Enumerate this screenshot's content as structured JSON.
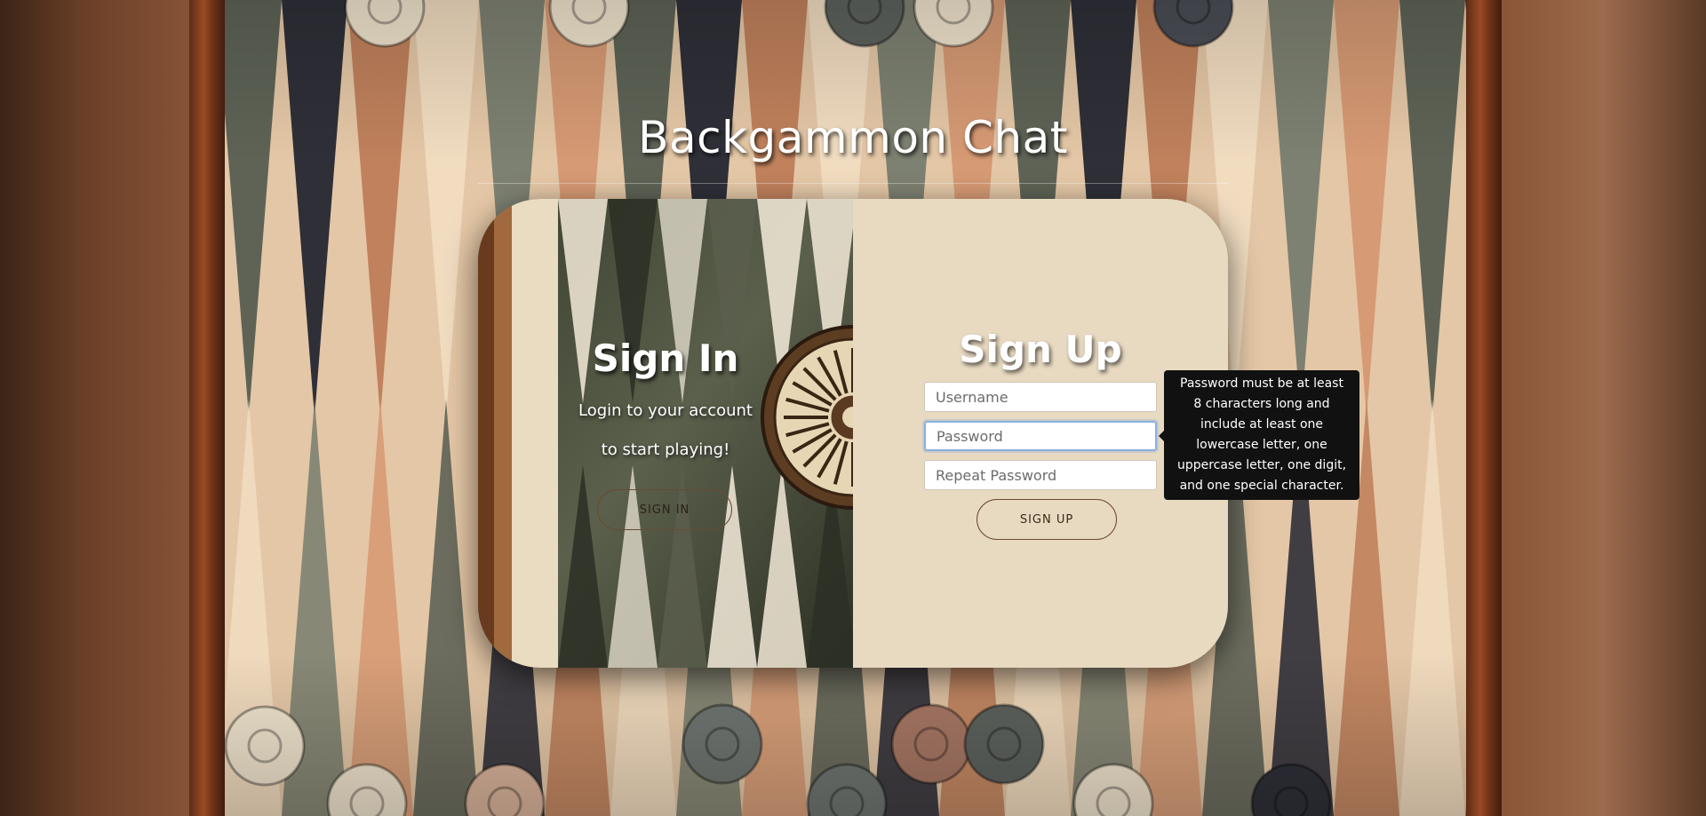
{
  "app": {
    "title": "Backgammon Chat"
  },
  "sign_in": {
    "heading": "Sign In",
    "line1": "Login to your account",
    "line2": "to start playing!",
    "button_label": "SIGN IN"
  },
  "sign_up": {
    "heading": "Sign Up",
    "username_placeholder": "Username",
    "password_placeholder": "Password",
    "repeat_password_placeholder": "Repeat Password",
    "button_label": "SIGN UP"
  },
  "tooltip": {
    "text": "Password must be at least 8 characters long and include at least one lowercase letter, one uppercase letter, one digit, and one special character."
  },
  "colors": {
    "card_right_bg": "#e8d9c1",
    "button_border": "#6b4a31",
    "tooltip_bg": "#111111",
    "focus_ring": "#8bb0de"
  }
}
